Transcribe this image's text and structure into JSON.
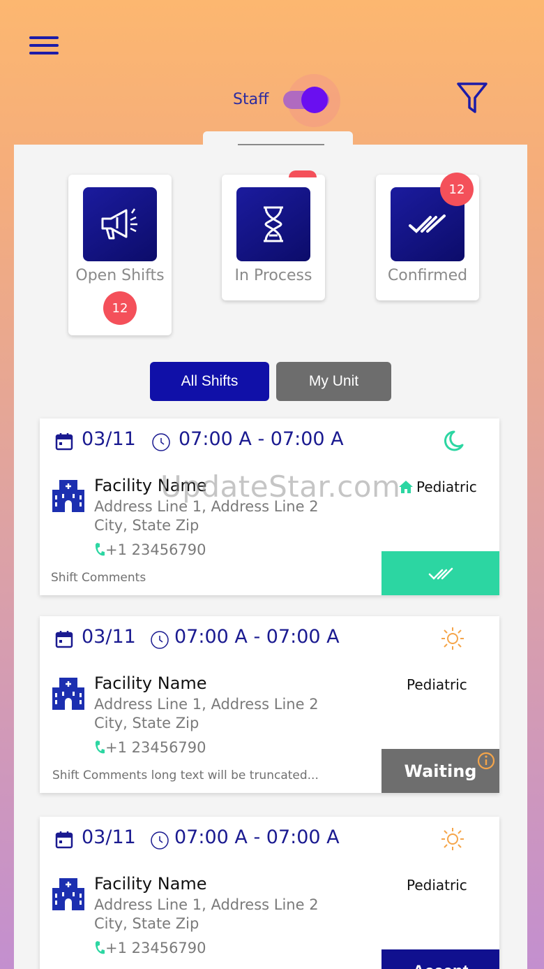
{
  "header": {
    "staff_label": "Staff",
    "toggle_on": true
  },
  "status_cards": [
    {
      "label": "Open Shifts",
      "badge": "12",
      "icon": "megaphone-icon"
    },
    {
      "label": "In Process",
      "badge": "",
      "icon": "hourglass-icon"
    },
    {
      "label": "Confirmed",
      "badge": "12",
      "icon": "double-check-icon"
    }
  ],
  "segments": {
    "all": "All Shifts",
    "mine": "My Unit"
  },
  "shifts": [
    {
      "date": "03/11",
      "time": "07:00 A - 07:00 A",
      "shift_icon": "moon-icon",
      "facility": "Facility Name",
      "address1": "Address Line 1, Address Line 2",
      "address2": "City, State Zip",
      "phone": "+1 23456790",
      "unit": "Pediatric",
      "comments": "Shift Comments",
      "action": "confirmed",
      "action_label": ""
    },
    {
      "date": "03/11",
      "time": "07:00 A - 07:00 A",
      "shift_icon": "sun-icon",
      "facility": "Facility Name",
      "address1": "Address Line 1, Address Line 2",
      "address2": "City, State Zip",
      "phone": "+1 23456790",
      "unit": "Pediatric",
      "comments": "Shift Comments long text will be truncated...",
      "action": "waiting",
      "action_label": "Waiting"
    },
    {
      "date": "03/11",
      "time": "07:00 A - 07:00 A",
      "shift_icon": "sun-icon",
      "facility": "Facility Name",
      "address1": "Address Line 1, Address Line 2",
      "address2": "City, State Zip",
      "phone": "+1 23456790",
      "unit": "Pediatric",
      "comments": "",
      "action": "accept",
      "action_label": "Accept"
    }
  ],
  "watermark": "UpdateStar.com",
  "colors": {
    "primary": "#1010a8",
    "confirm": "#2cd6a2",
    "waiting": "#6e6e6e",
    "badge": "#f4505a",
    "accent_teal": "#2cd6a2",
    "sun": "#f5a54a"
  }
}
